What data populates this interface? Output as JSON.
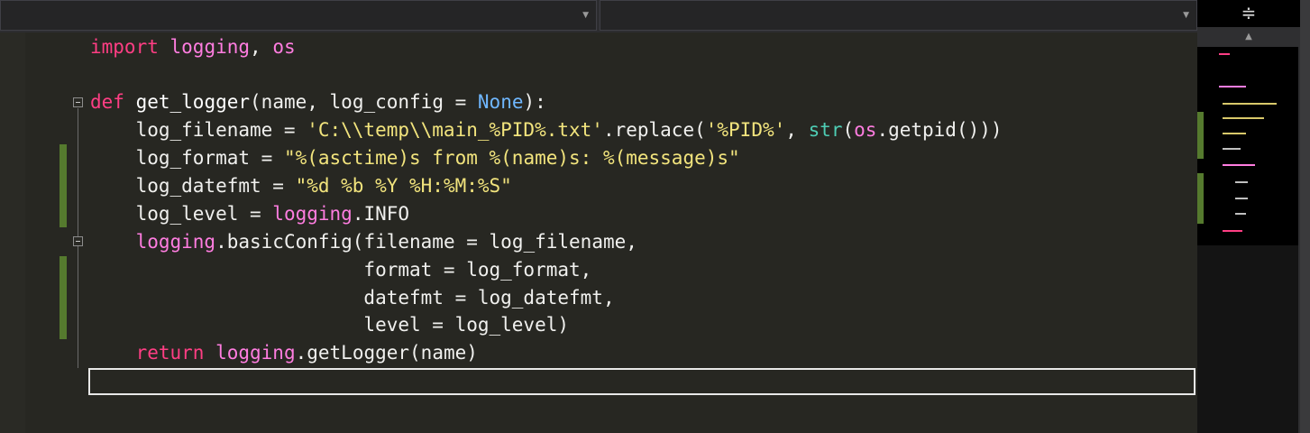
{
  "navigation_bar": {
    "left_dropdown_value": "",
    "right_dropdown_value": "",
    "dropdown_arrow_icon": "chevron-down-icon"
  },
  "editor": {
    "code_lines": [
      "import logging, os",
      "",
      "def get_logger(name, log_config = None):",
      "    log_filename = 'C:\\\\temp\\\\main_%PID%.txt'.replace('%PID%', str(os.getpid()))",
      "    log_format = \"%(asctime)s from %(name)s: %(message)s\"",
      "    log_datefmt = \"%d %b %Y %H:%M:%S\"",
      "    log_level = logging.INFO",
      "    logging.basicConfig(filename = log_filename,",
      "                        format = log_format,",
      "                        datefmt = log_datefmt,",
      "                        level = log_level)",
      "    return logging.getLogger(name)",
      ""
    ],
    "syntax_colors": {
      "keyword": "#ff3e84",
      "module": "#ff7de0",
      "string": "#f2e47d",
      "none_constant": "#6fb7ff",
      "builtin": "#4ecdb4",
      "default_text": "#f0f0ee",
      "change_marker": "#557a2e",
      "background": "#272722"
    },
    "fold_icon": "collapse-minus-icon"
  },
  "side_panel": {
    "split_icon": "split-window-icon",
    "scroll_up_icon": "scroll-up-arrow-icon",
    "minimap_label": "code minimap"
  }
}
